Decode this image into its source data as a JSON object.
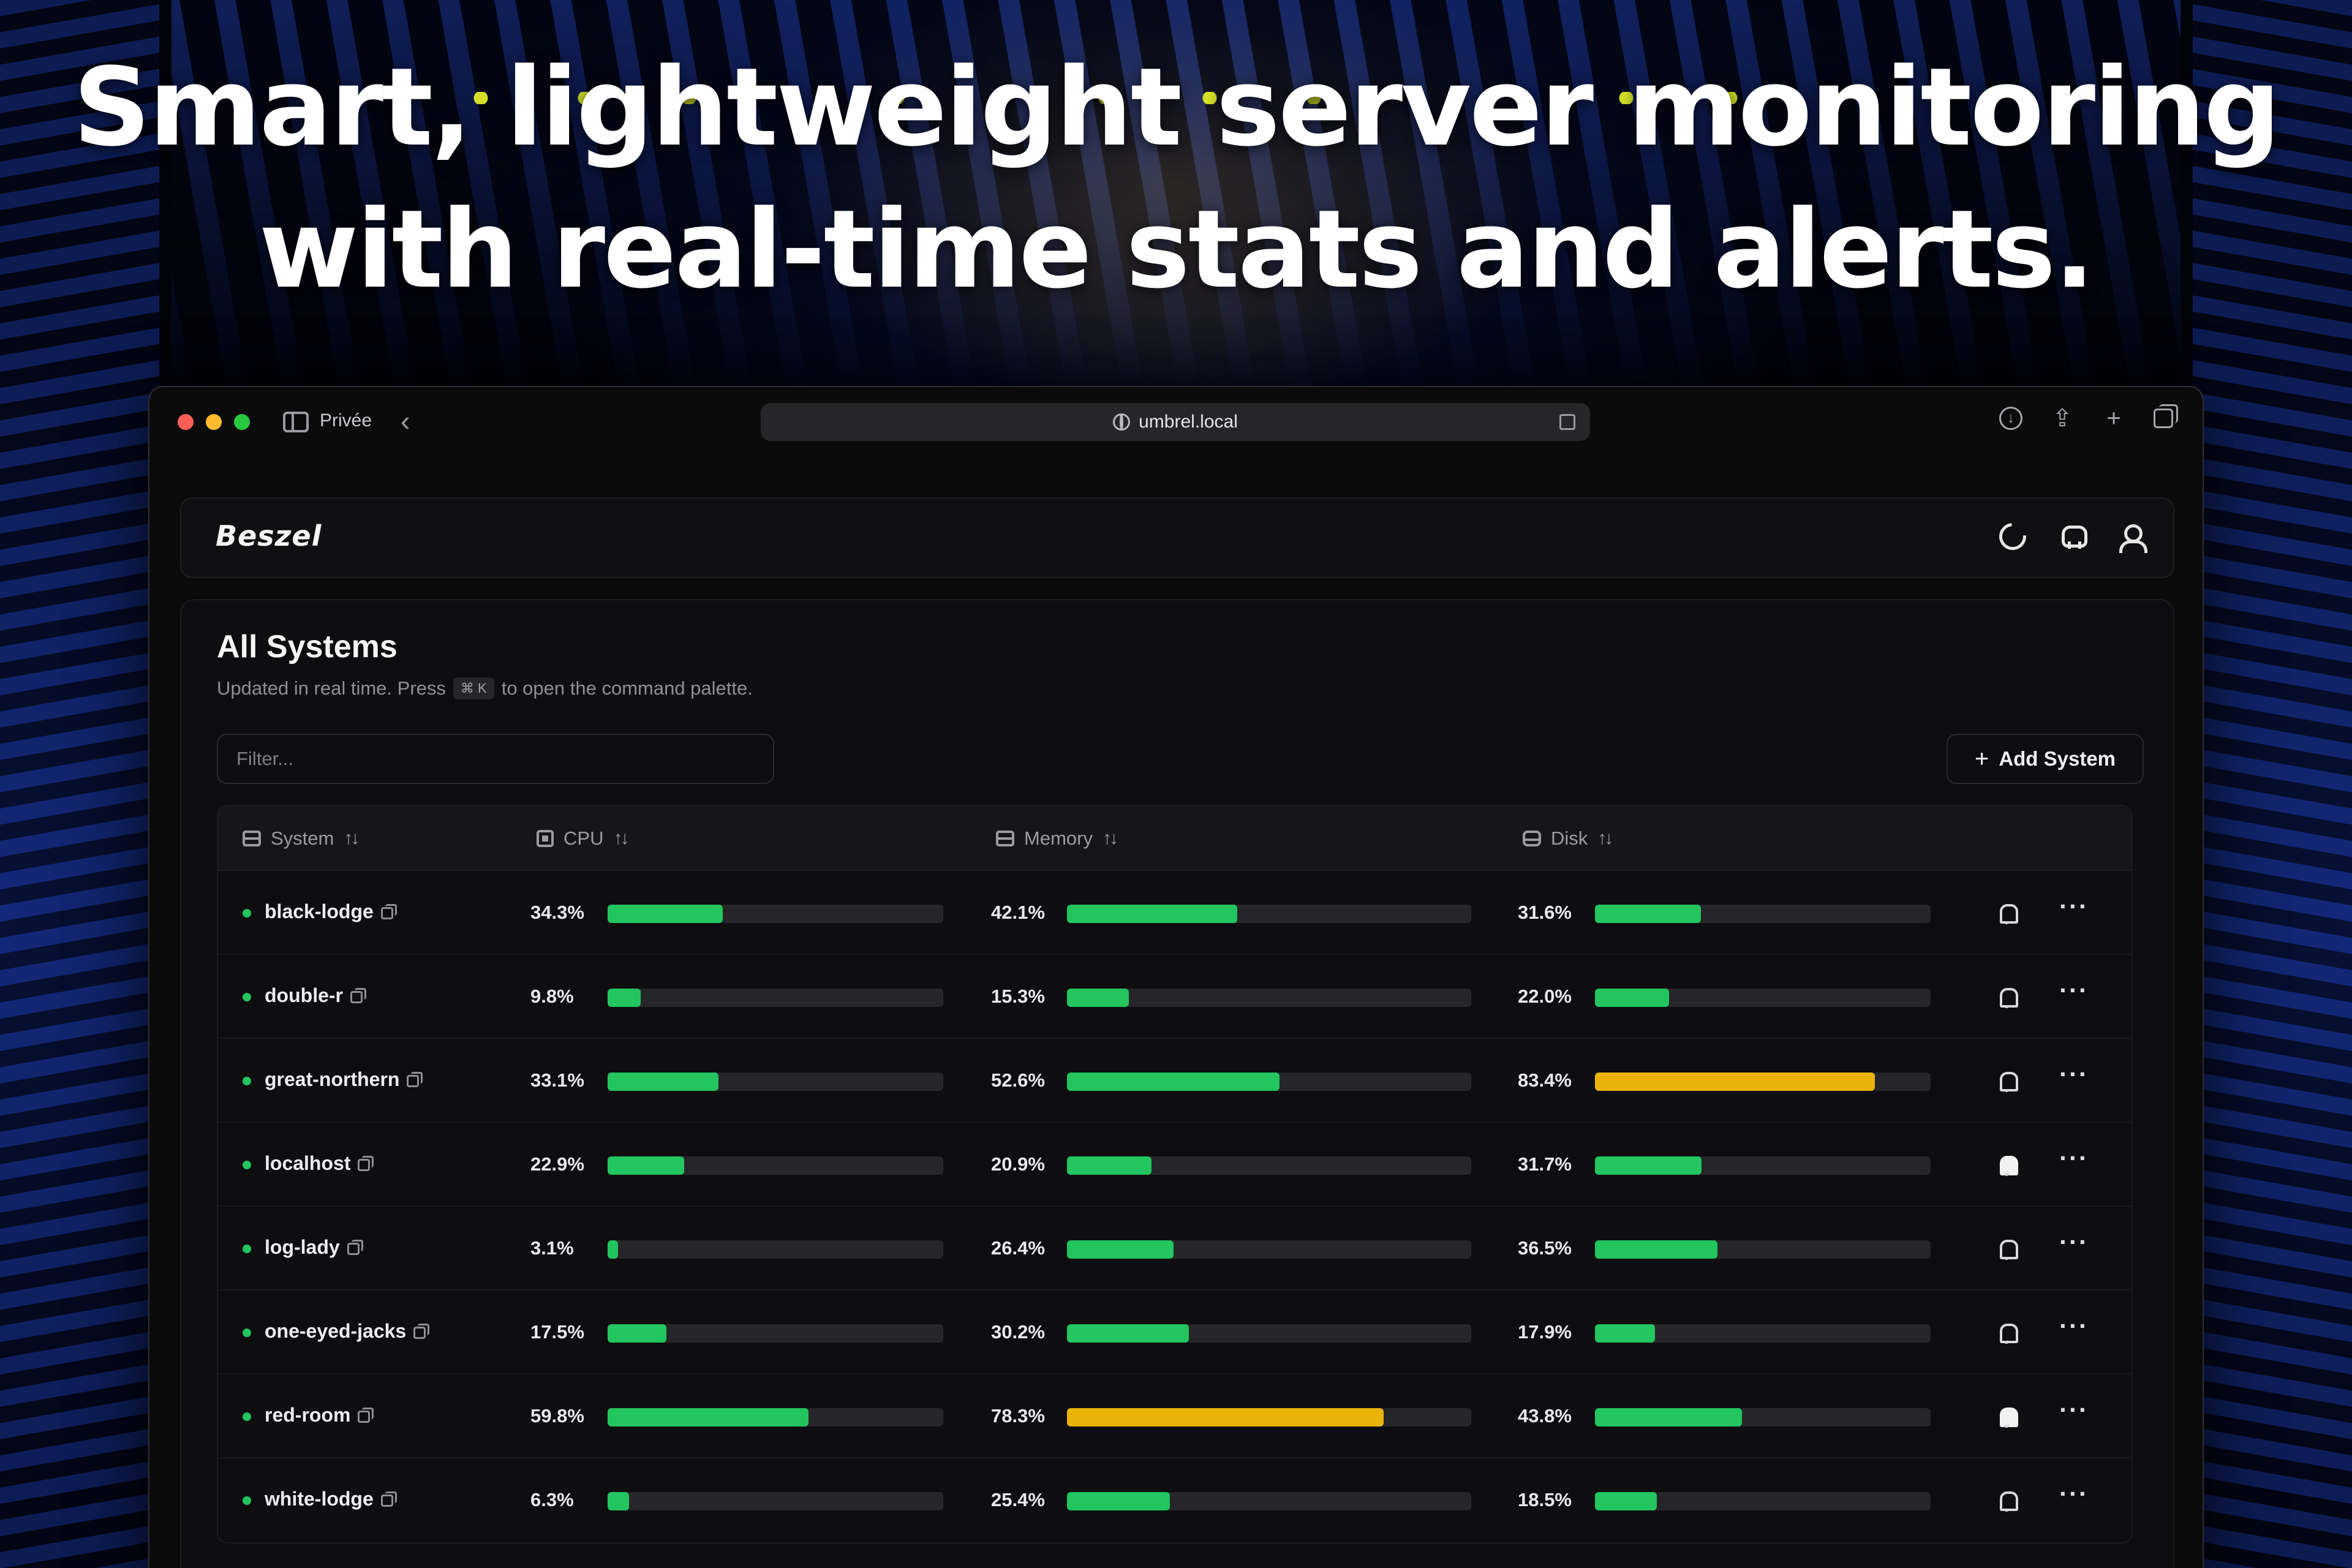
{
  "headline": {
    "line1": "Smart, lightweight server monitoring",
    "line2": "with real-time stats and alerts."
  },
  "browser": {
    "profile_label": "Privée",
    "url": "umbrel.local",
    "traffic_colors": [
      "#ff5f57",
      "#febc2e",
      "#28c840"
    ]
  },
  "app": {
    "logo": "Beszel",
    "header_icons": [
      "moon-icon",
      "github-icon",
      "user-icon"
    ]
  },
  "card": {
    "title": "All Systems",
    "subtitle_before": "Updated in real time. Press",
    "shortcut": "⌘ K",
    "subtitle_after": "to open the command palette.",
    "filter_placeholder": "Filter...",
    "add_button": "Add System"
  },
  "table": {
    "columns": [
      "System",
      "CPU",
      "Memory",
      "Disk"
    ],
    "colors": {
      "ok": "#22c55e",
      "warn": "#eab308",
      "status_up": "#22c55e"
    },
    "rows": [
      {
        "name": "black-lodge",
        "cpu": "34.3%",
        "cpu_v": 34.3,
        "mem": "42.1%",
        "mem_v": 42.1,
        "disk": "31.6%",
        "disk_v": 31.6,
        "alerts": false
      },
      {
        "name": "double-r",
        "cpu": "9.8%",
        "cpu_v": 9.8,
        "mem": "15.3%",
        "mem_v": 15.3,
        "disk": "22.0%",
        "disk_v": 22.0,
        "alerts": false
      },
      {
        "name": "great-northern",
        "cpu": "33.1%",
        "cpu_v": 33.1,
        "mem": "52.6%",
        "mem_v": 52.6,
        "disk": "83.4%",
        "disk_v": 83.4,
        "alerts": false
      },
      {
        "name": "localhost",
        "cpu": "22.9%",
        "cpu_v": 22.9,
        "mem": "20.9%",
        "mem_v": 20.9,
        "disk": "31.7%",
        "disk_v": 31.7,
        "alerts": true
      },
      {
        "name": "log-lady",
        "cpu": "3.1%",
        "cpu_v": 3.1,
        "mem": "26.4%",
        "mem_v": 26.4,
        "disk": "36.5%",
        "disk_v": 36.5,
        "alerts": false
      },
      {
        "name": "one-eyed-jacks",
        "cpu": "17.5%",
        "cpu_v": 17.5,
        "mem": "30.2%",
        "mem_v": 30.2,
        "disk": "17.9%",
        "disk_v": 17.9,
        "alerts": false
      },
      {
        "name": "red-room",
        "cpu": "59.8%",
        "cpu_v": 59.8,
        "mem": "78.3%",
        "mem_v": 78.3,
        "disk": "43.8%",
        "disk_v": 43.8,
        "alerts": true
      },
      {
        "name": "white-lodge",
        "cpu": "6.3%",
        "cpu_v": 6.3,
        "mem": "25.4%",
        "mem_v": 25.4,
        "disk": "18.5%",
        "disk_v": 18.5,
        "alerts": false
      }
    ]
  }
}
